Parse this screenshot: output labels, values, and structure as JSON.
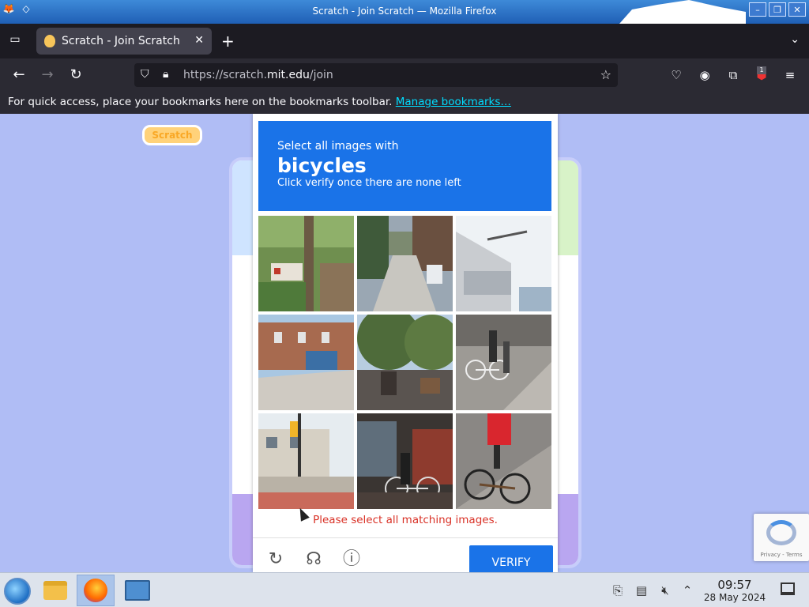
{
  "os": {
    "window_title": "Scratch - Join Scratch — Mozilla Firefox",
    "controls": [
      "–",
      "❐",
      "✕"
    ]
  },
  "browser": {
    "tab": {
      "title": "Scratch - Join Scratch",
      "close": "✕"
    },
    "new_tab": "+",
    "url_prefix": "https://scratch.",
    "url_domain": "mit.edu",
    "url_path": "/join",
    "bookmarks_text": "For quick access, place your bookmarks here on the bookmarks toolbar.",
    "bookmarks_link": "Manage bookmarks…",
    "extension_badge": "1"
  },
  "page": {
    "logo_text": "Scratch"
  },
  "captcha": {
    "line1": "Select all images with",
    "line2": "bicycles",
    "line3": "Click verify once there are none left",
    "error": "Please select all matching images.",
    "verify_label": "VERIFY",
    "badge_text": "Privacy - Terms"
  },
  "taskbar": {
    "time": "09:57",
    "date": "28 May 2024"
  }
}
